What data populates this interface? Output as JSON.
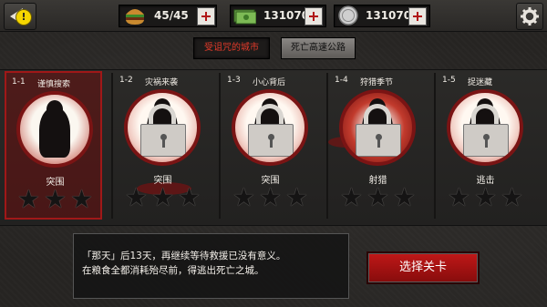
{
  "resources": {
    "food": "45/45",
    "cash": "131070",
    "coin": "131070"
  },
  "alert_badge": "!",
  "region_tabs": [
    {
      "label": "受诅咒的城市",
      "active": true
    },
    {
      "label": "死亡高速公路",
      "active": false
    }
  ],
  "stages": [
    {
      "num": "1-1",
      "title": "谨慎搜索",
      "type": "突围",
      "locked": false,
      "selected": true,
      "stars": 0
    },
    {
      "num": "1-2",
      "title": "灾祸来袭",
      "type": "突围",
      "locked": true,
      "selected": false,
      "stars": 0
    },
    {
      "num": "1-3",
      "title": "小心背后",
      "type": "突围",
      "locked": true,
      "selected": false,
      "stars": 0
    },
    {
      "num": "1-4",
      "title": "狩猎季节",
      "type": "射猎",
      "locked": true,
      "selected": false,
      "stars": 0
    },
    {
      "num": "1-5",
      "title": "捉迷藏",
      "type": "逃击",
      "locked": true,
      "selected": false,
      "stars": 0
    }
  ],
  "story": {
    "line1": "「那天」后13天，再继续等待救援已没有意义。",
    "line2": "在粮食全都消耗殆尽前，得逃出死亡之城。"
  },
  "select_button": "选择关卡",
  "colors": {
    "accent_red": "#b01616",
    "tab_active_text": "#e23a2a"
  }
}
